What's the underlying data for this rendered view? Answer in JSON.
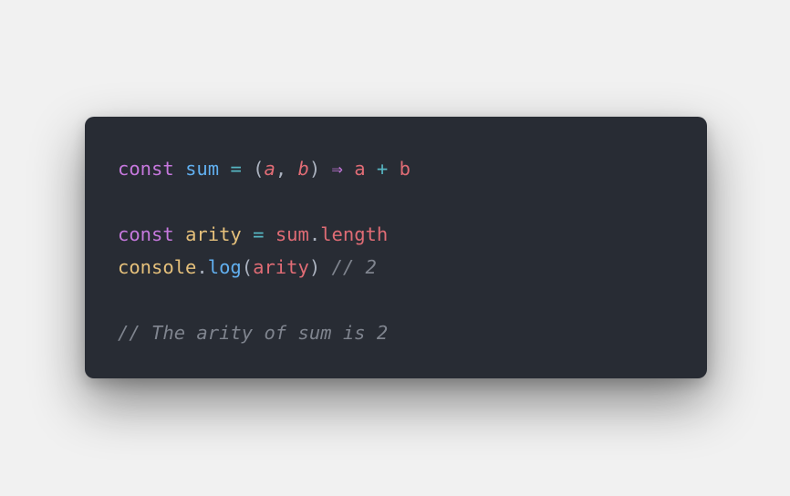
{
  "colors": {
    "background": "#f1f1f1",
    "card": "#282c34",
    "keyword": "#c678dd",
    "function": "#61afef",
    "operator": "#56b6c2",
    "punctuation": "#abb2bf",
    "variable": "#e06c75",
    "constant": "#e5c07b",
    "comment": "#7f848e"
  },
  "code": {
    "line1": {
      "kw": "const",
      "name": "sum",
      "eq": "=",
      "open": "(",
      "param_a": "a",
      "comma": ",",
      "param_b": "b",
      "close": ")",
      "arrow": "⇒",
      "a": "a",
      "plus": "+",
      "b": "b"
    },
    "line2": {
      "kw": "const",
      "name": "arity",
      "eq": "=",
      "obj": "sum",
      "dot": ".",
      "prop": "length"
    },
    "line3": {
      "obj": "console",
      "dot": ".",
      "method": "log",
      "open": "(",
      "arg": "arity",
      "close": ")",
      "comment": "// 2"
    },
    "line4": {
      "comment": "// The arity of sum is 2"
    }
  }
}
